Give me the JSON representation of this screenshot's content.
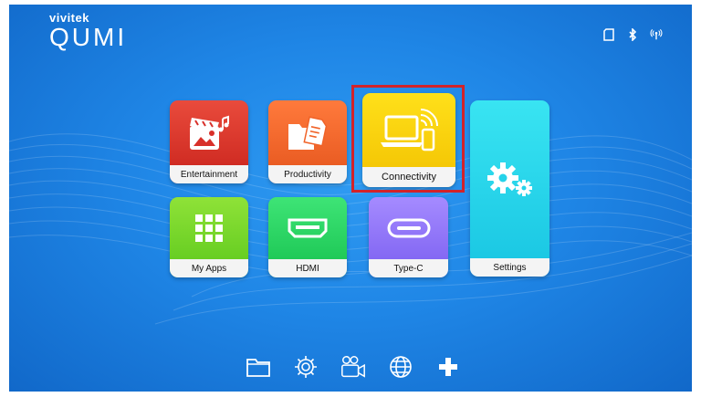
{
  "brand": {
    "small": "vivitek",
    "big": "QUMI"
  },
  "status_icons": [
    "sd-card-icon",
    "bluetooth-icon",
    "wireless-signal-icon"
  ],
  "tiles": {
    "entertainment": {
      "label": "Entertainment",
      "icon": "media-icon"
    },
    "productivity": {
      "label": "Productivity",
      "icon": "documents-icon"
    },
    "connectivity": {
      "label": "Connectivity",
      "icon": "laptop-phone-icon"
    },
    "settings": {
      "label": "Settings",
      "icon": "gears-icon"
    },
    "my_apps": {
      "label": "My Apps",
      "icon": "app-grid-icon"
    },
    "hdmi": {
      "label": "HDMI",
      "icon": "hdmi-port-icon"
    },
    "type_c": {
      "label": "Type-C",
      "icon": "usb-c-port-icon"
    }
  },
  "selected_tile": "connectivity",
  "dock": [
    "folder-icon",
    "settings-gear-icon",
    "camera-icon",
    "globe-icon",
    "add-icon"
  ],
  "colors": {
    "background": "#1f86e6",
    "selection": "#d2232a",
    "entertainment": "#d8302a",
    "productivity": "#f06227",
    "connectivity": "#f9d20a",
    "settings": "#25d3ea",
    "my_apps": "#74d52a",
    "hdmi": "#22cc5e",
    "type_c": "#8b6ff5"
  }
}
